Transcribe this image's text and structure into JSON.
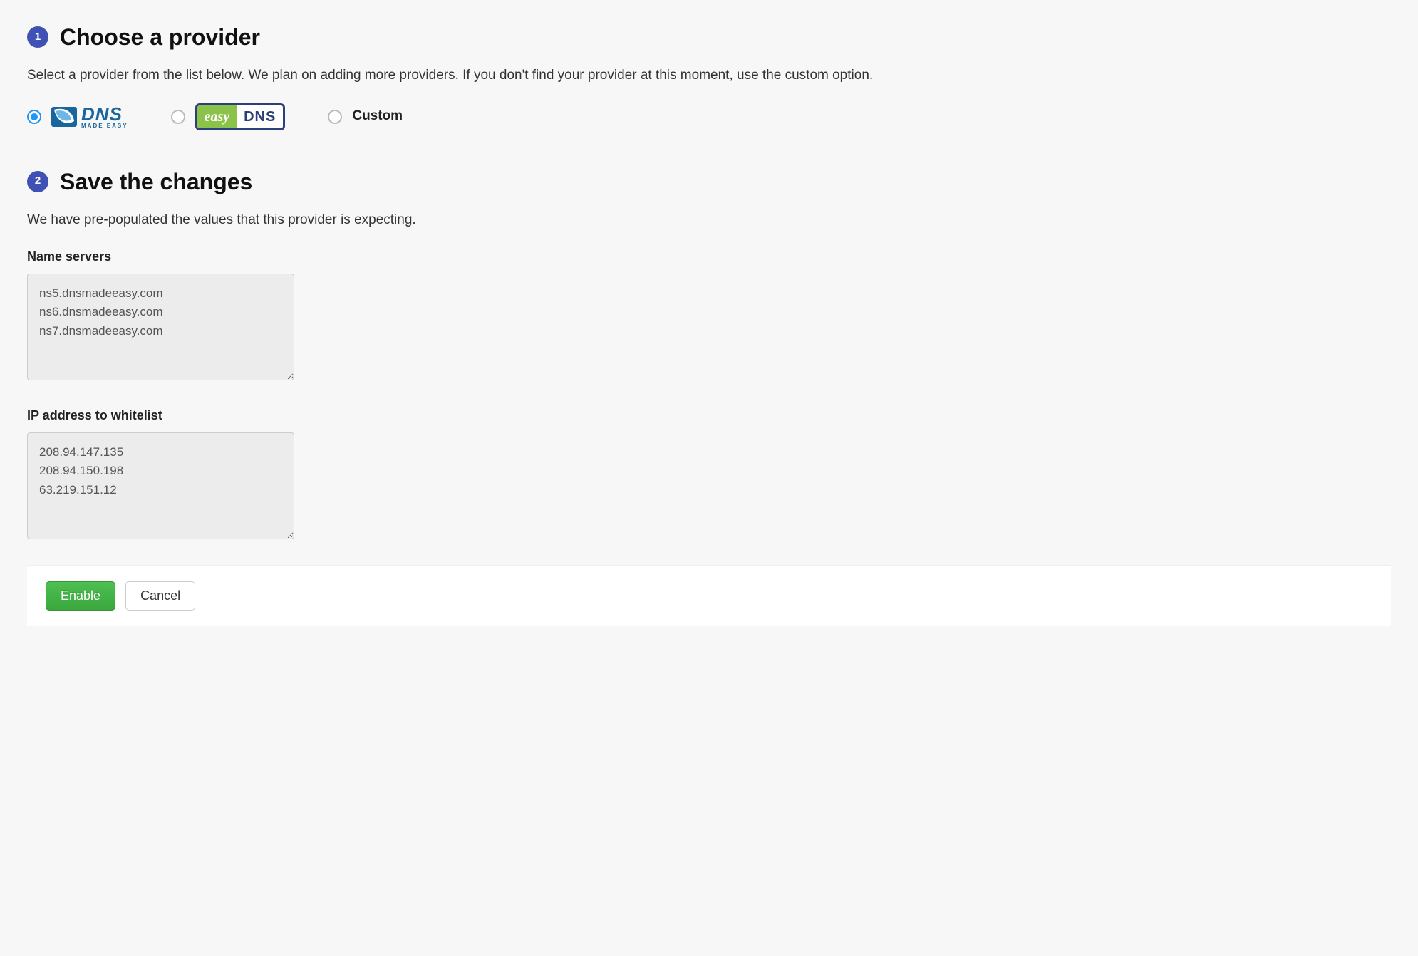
{
  "step1": {
    "number": "1",
    "title": "Choose a provider",
    "description": "Select a provider from the list below. We plan on adding more providers. If you don't find your provider at this moment, use the custom option.",
    "providers": {
      "dnsmadeeasy": {
        "dns": "DNS",
        "sub": "MADE EASY",
        "selected": true
      },
      "easydns": {
        "easy": "easy",
        "dns": "DNS",
        "selected": false
      },
      "custom": {
        "label": "Custom",
        "selected": false
      }
    }
  },
  "step2": {
    "number": "2",
    "title": "Save the changes",
    "description": "We have pre-populated the values that this provider is expecting.",
    "fields": {
      "nameservers": {
        "label": "Name servers",
        "value": "ns5.dnsmadeeasy.com\nns6.dnsmadeeasy.com\nns7.dnsmadeeasy.com"
      },
      "whitelist": {
        "label": "IP address to whitelist",
        "value": "208.94.147.135\n208.94.150.198\n63.219.151.12"
      }
    }
  },
  "actions": {
    "enable": "Enable",
    "cancel": "Cancel"
  },
  "colors": {
    "step_badge": "#3f51b5",
    "radio_selected": "#2196f3",
    "primary_button": "#43b446"
  }
}
